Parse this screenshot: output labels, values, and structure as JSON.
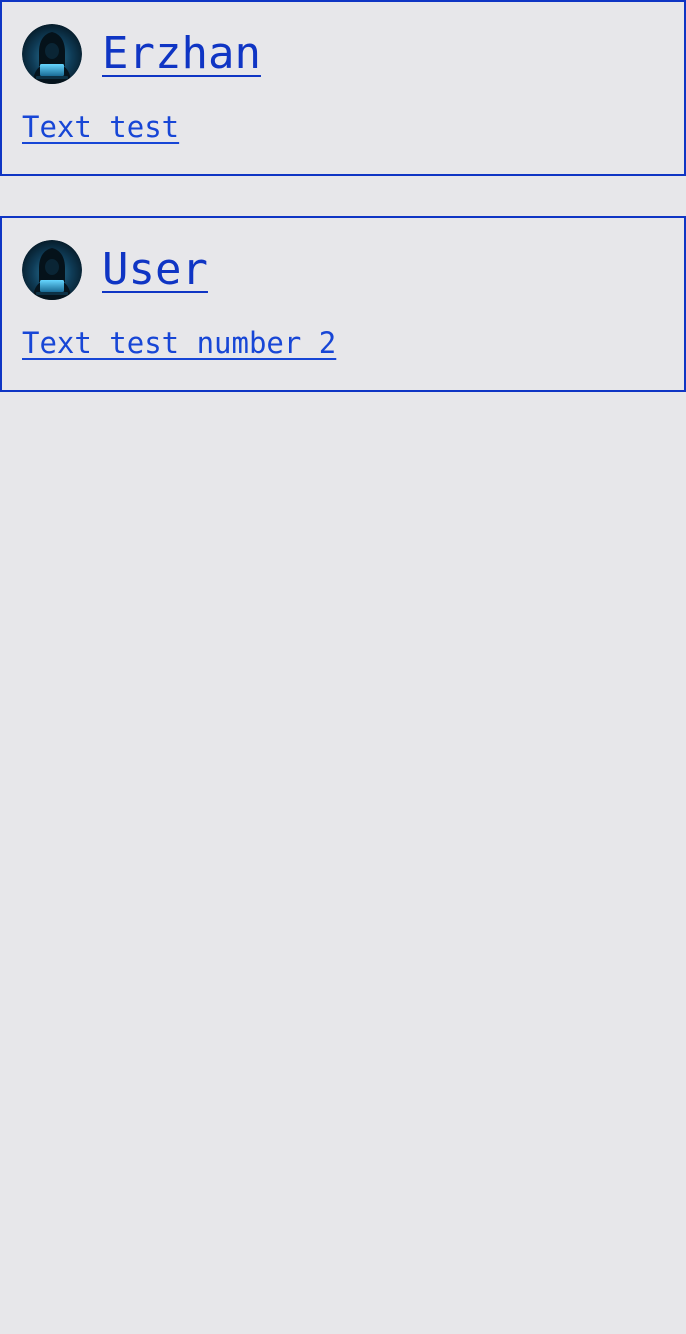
{
  "colors": {
    "background": "#e7e7ea",
    "border": "#0f35c4",
    "link": "#0f35c4",
    "text_link": "#1746d6"
  },
  "posts": [
    {
      "author": "Erzhan",
      "text": "Text test",
      "avatar_icon": "hooded-hacker-avatar"
    },
    {
      "author": "User",
      "text": "Text test number 2",
      "avatar_icon": "hooded-hacker-avatar"
    }
  ]
}
